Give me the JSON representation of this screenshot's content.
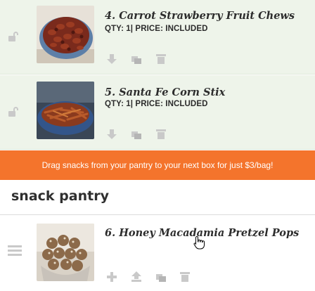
{
  "next_box": {
    "items": [
      {
        "number": "4.",
        "name": "Carrot Strawberry Fruit Chews",
        "meta": "QTY: 1| PRICE: INCLUDED",
        "image": "carrot-strawberry-fruit-chews-photo"
      },
      {
        "number": "5.",
        "name": "Santa Fe Corn Stix",
        "meta": "QTY: 1| PRICE: INCLUDED",
        "image": "santa-fe-corn-stix-photo"
      }
    ],
    "item_icons": [
      "lock-icon",
      "move-down-icon",
      "swap-icon",
      "trash-icon"
    ]
  },
  "banner": {
    "text": "Drag snacks from your pantry to your next box for just $3/bag!",
    "color": "#f4742c"
  },
  "pantry": {
    "heading": "snack pantry",
    "items": [
      {
        "number": "6.",
        "name": "Honey Macadamia Pretzel Pops",
        "image": "honey-macadamia-pretzel-pops-photo"
      }
    ],
    "item_icons": [
      "drag-handle-icon",
      "add-icon",
      "move-to-box-icon",
      "swap-icon",
      "trash-icon"
    ]
  },
  "colors": {
    "row_background": "#eef4ea",
    "icon_gray": "#c9c9c9",
    "text": "#2c2c2c"
  }
}
